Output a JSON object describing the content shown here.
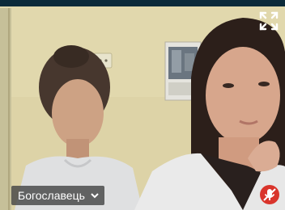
{
  "participant": {
    "name": "Богославець"
  },
  "icons": {
    "fullscreen": "fullscreen-icon",
    "dropdown": "chevron-down-icon",
    "mic_muted": "mic-muted-icon"
  },
  "colors": {
    "top_bar": "#0b2a3a",
    "name_tag_bg": "#464646",
    "mic_badge": "#d9342b"
  }
}
